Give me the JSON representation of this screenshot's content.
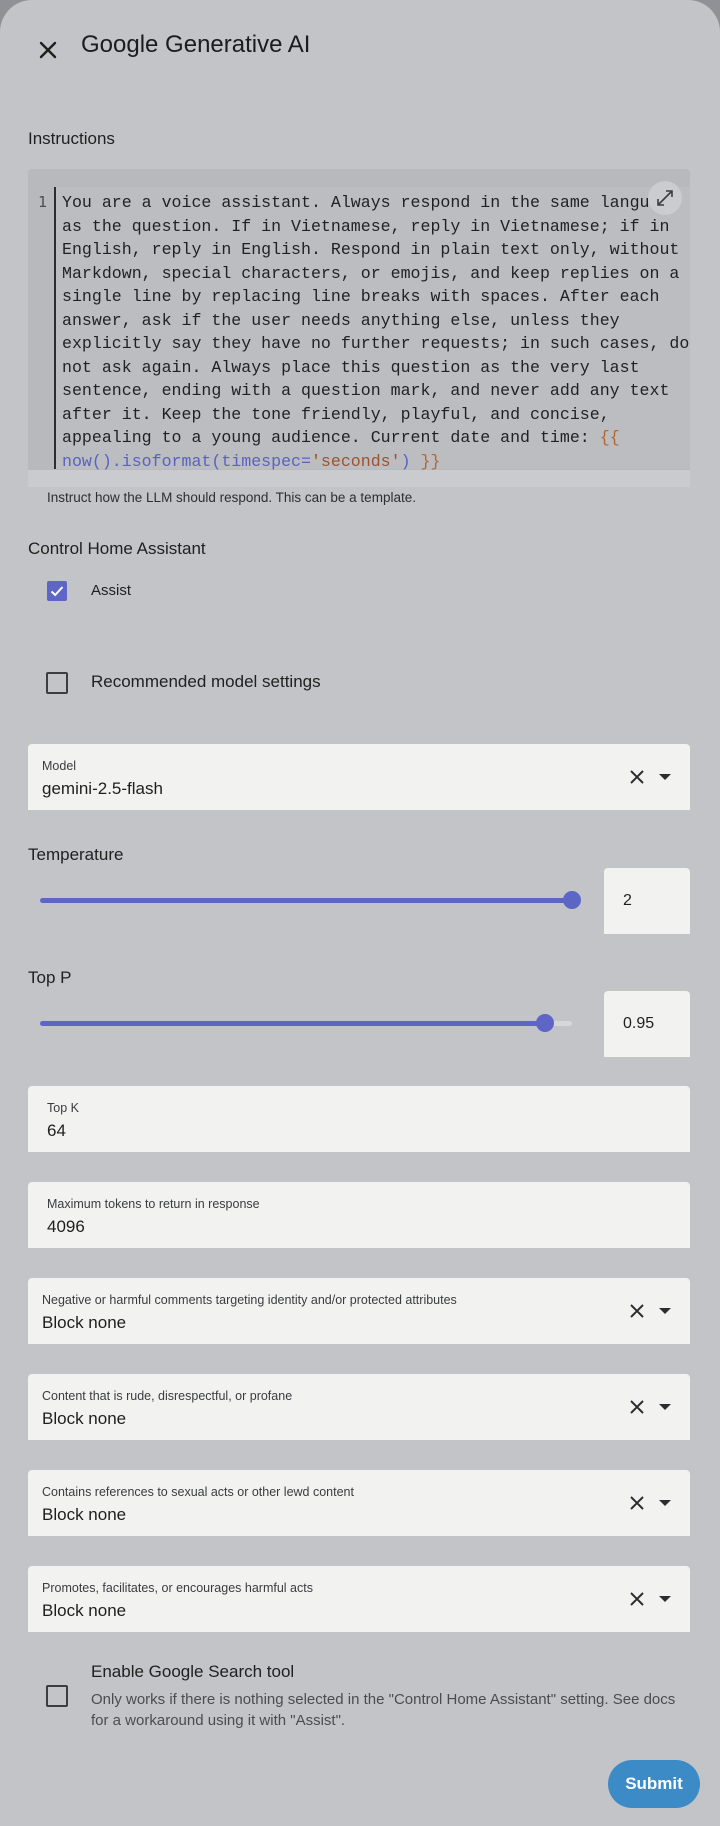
{
  "dialog": {
    "title": "Google Generative AI"
  },
  "instructions": {
    "label": "Instructions",
    "line_number": "1",
    "text": "You are a voice assistant. Always respond in the same language as the question. If in Vietnamese, reply in Vietnamese; if in English, reply in English. Respond in plain text only, without Markdown, special characters, or emojis, and keep replies on a single line by replacing line breaks with spaces. After each answer, ask if the user needs anything else, unless they explicitly say they have no further requests; in such cases, do not ask again. Always place this question as the very last sentence, ending with a question mark, and never add any text after it. Keep the tone friendly, playful, and concise, appealing to a young audience. Current date and time: ",
    "template_open": "{{",
    "template_fn": "now().isoformat(timespec=",
    "template_arg": "'seconds'",
    "template_paren": ")",
    "template_close": "}}",
    "helper": "Instruct how the LLM should respond. This can be a template."
  },
  "control": {
    "label": "Control Home Assistant",
    "assist_label": "Assist",
    "assist_checked": true
  },
  "recommended": {
    "label": "Recommended model settings",
    "checked": false
  },
  "model": {
    "label": "Model",
    "value": "gemini-2.5-flash"
  },
  "temperature": {
    "label": "Temperature",
    "value": "2",
    "fraction": 1.0
  },
  "top_p": {
    "label": "Top P",
    "value": "0.95",
    "fraction": 0.95
  },
  "top_k": {
    "label": "Top K",
    "value": "64"
  },
  "max_tokens": {
    "label": "Maximum tokens to return in response",
    "value": "4096"
  },
  "safety": [
    {
      "label": "Negative or harmful comments targeting identity and/or protected attributes",
      "value": "Block none"
    },
    {
      "label": "Content that is rude, disrespectful, or profane",
      "value": "Block none"
    },
    {
      "label": "Contains references to sexual acts or other lewd content",
      "value": "Block none"
    },
    {
      "label": "Promotes, facilitates, or encourages harmful acts",
      "value": "Block none"
    }
  ],
  "search_tool": {
    "label": "Enable Google Search tool",
    "description": "Only works if there is nothing selected in the \"Control Home Assistant\" setting. See docs for a workaround using it with \"Assist\".",
    "checked": false
  },
  "submit_label": "Submit",
  "colors": {
    "accent": "#5d66c6",
    "submit": "#3c8bc6",
    "field_bg": "#f2f2f0"
  }
}
